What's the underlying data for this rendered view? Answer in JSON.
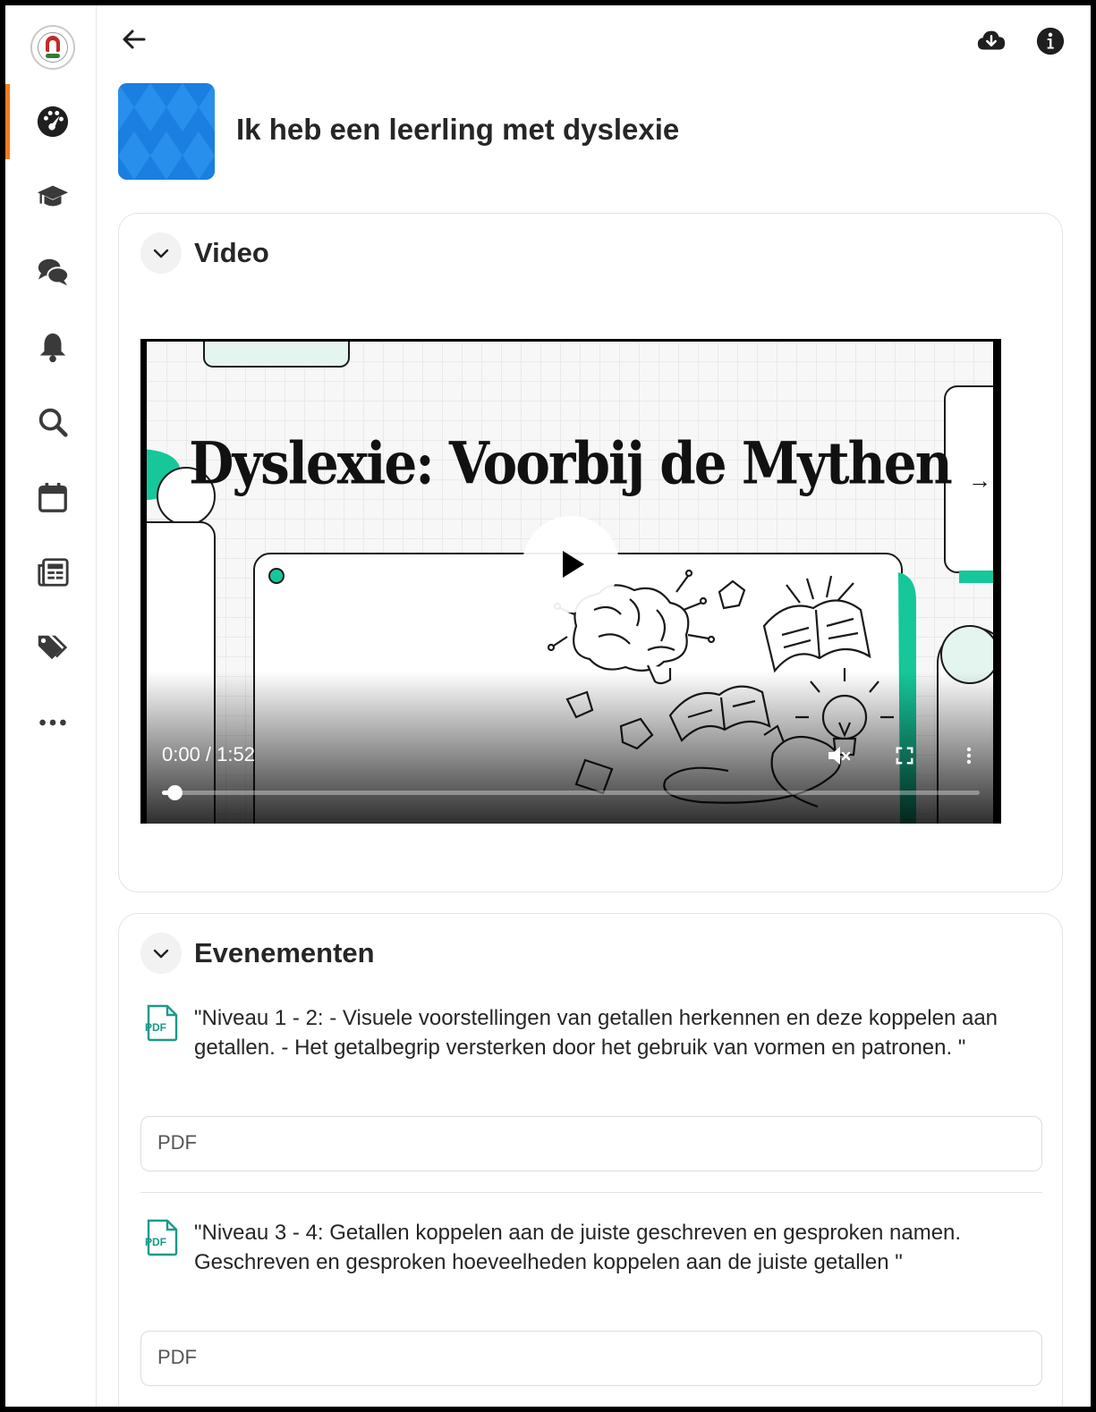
{
  "topbar": {
    "back_icon": "arrow-left-icon",
    "download_icon": "cloud-download-icon",
    "info_icon": "info-icon"
  },
  "sidebar": {
    "items": [
      {
        "icon": "dashboard-icon",
        "active": true
      },
      {
        "icon": "graduation-cap-icon"
      },
      {
        "icon": "chat-bubbles-icon"
      },
      {
        "icon": "bell-icon"
      },
      {
        "icon": "search-icon"
      },
      {
        "icon": "calendar-icon"
      },
      {
        "icon": "newspaper-icon"
      },
      {
        "icon": "tags-icon"
      },
      {
        "icon": "more-horizontal-icon"
      }
    ],
    "accent_color": "#f47c20"
  },
  "header": {
    "title": "Ik heb een leerling met dyslexie",
    "thumbnail_color": "#1a7fe0"
  },
  "video_section": {
    "title": "Video",
    "player": {
      "slide_title": "Dyslexie: Voorbij de Mythen",
      "time": "0:00 / 1:52",
      "progress": 0.01,
      "next_glyph": "→"
    }
  },
  "events_section": {
    "title": "Evenementen",
    "items": [
      {
        "icon_label": "PDF",
        "text": "\"Niveau 1 - 2: - Visuele voorstellingen van getallen herkennen en deze koppelen aan getallen. - Het getalbegrip versterken door het gebruik van vormen en patronen. \"",
        "field_label": "PDF"
      },
      {
        "icon_label": "PDF",
        "text": "\"Niveau 3 - 4: Getallen koppelen aan de juiste geschreven en gesproken namen. Geschreven en gesproken hoeveelheden koppelen aan de juiste getallen \"",
        "field_label": "PDF"
      }
    ],
    "accent_color": "#1a9a8a"
  }
}
